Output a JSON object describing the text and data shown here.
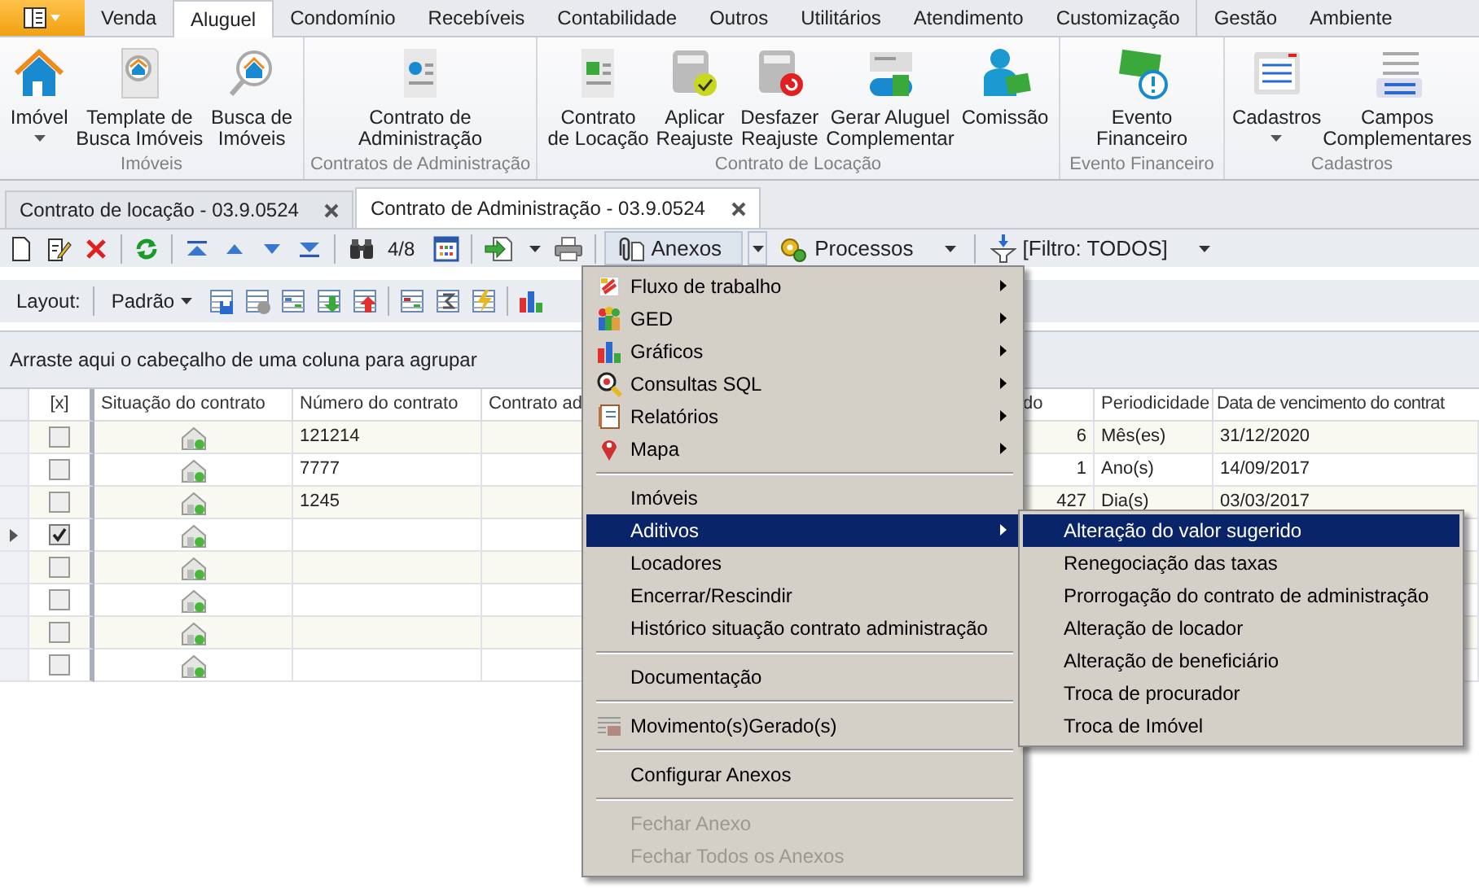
{
  "ribbon": {
    "tabs": [
      {
        "label": "Venda",
        "selected": false
      },
      {
        "label": "Aluguel",
        "selected": true
      },
      {
        "label": "Condomínio",
        "selected": false
      },
      {
        "label": "Recebíveis",
        "selected": false
      },
      {
        "label": "Contabilidade",
        "selected": false
      },
      {
        "label": "Outros",
        "selected": false
      },
      {
        "label": "Utilitários",
        "selected": false
      },
      {
        "label": "Atendimento",
        "selected": false
      },
      {
        "label": "Customização",
        "selected": false
      },
      {
        "label": "Gestão",
        "selected": false
      },
      {
        "label": "Ambiente",
        "selected": false
      }
    ],
    "groups": [
      {
        "title": "Imóveis",
        "buttons": [
          {
            "lines": [
              "Imóvel"
            ],
            "dropdown": true
          },
          {
            "lines": [
              "Template de",
              "Busca Imóveis"
            ],
            "dropdown": false
          },
          {
            "lines": [
              "Busca de",
              "Imóveis"
            ],
            "dropdown": false
          }
        ]
      },
      {
        "title": "Contratos de Administração",
        "buttons": [
          {
            "lines": [
              "Contrato de",
              "Administração"
            ],
            "dropdown": false
          }
        ]
      },
      {
        "title": "Contrato de Locação",
        "buttons": [
          {
            "lines": [
              "Contrato",
              "de Locação"
            ],
            "dropdown": false
          },
          {
            "lines": [
              "Aplicar",
              "Reajuste"
            ],
            "dropdown": false
          },
          {
            "lines": [
              "Desfazer",
              "Reajuste"
            ],
            "dropdown": false
          },
          {
            "lines": [
              "Gerar Aluguel",
              "Complementar"
            ],
            "dropdown": false
          },
          {
            "lines": [
              "Comissão"
            ],
            "dropdown": false
          }
        ]
      },
      {
        "title": "Evento Financeiro",
        "buttons": [
          {
            "lines": [
              "Evento",
              "Financeiro"
            ],
            "dropdown": false
          }
        ]
      },
      {
        "title": "Cadastros",
        "buttons": [
          {
            "lines": [
              "Cadastros"
            ],
            "dropdown": true
          },
          {
            "lines": [
              "Campos",
              "Complementares"
            ],
            "dropdown": false
          }
        ]
      }
    ]
  },
  "document_tabs": [
    {
      "label": "Contrato de locação - 03.9.0524",
      "selected": false
    },
    {
      "label": "Contrato de Administração - 03.9.0524",
      "selected": true
    }
  ],
  "toolbar": {
    "record_counter": "4/8",
    "attachments": "Anexos",
    "processes": "Processos",
    "filter": "[Filtro: TODOS]"
  },
  "layout_bar": {
    "label": "Layout:",
    "value": "Padrão"
  },
  "group_panel": "Arraste aqui o cabeçalho de uma coluna para agrupar",
  "table": {
    "columns": [
      "[x]",
      "Situação do contrato",
      "Número do contrato",
      "Contrato ad",
      "do",
      "Periodicidade",
      "Data de vencimento do contrat"
    ],
    "rows": [
      {
        "checked": false,
        "current": false,
        "number": "121214",
        "column_5": "6",
        "period": "Mês(es)",
        "due_date": "31/12/2020"
      },
      {
        "checked": false,
        "current": false,
        "number": "7777",
        "column_5": "1",
        "period": "Ano(s)",
        "due_date": "14/09/2017"
      },
      {
        "checked": false,
        "current": false,
        "number": "1245",
        "column_5": "427",
        "period": "Dia(s)",
        "due_date": "03/03/2017"
      },
      {
        "checked": true,
        "current": true
      },
      {
        "checked": false,
        "current": false
      },
      {
        "checked": false,
        "current": false
      },
      {
        "checked": false,
        "current": false
      },
      {
        "checked": false,
        "current": false
      }
    ]
  },
  "menu": {
    "items": [
      {
        "kind": "item",
        "label": "Fluxo de trabalho",
        "submenu": true,
        "selected": false,
        "disabled": false
      },
      {
        "kind": "item",
        "label": "GED",
        "submenu": true,
        "selected": false,
        "disabled": false
      },
      {
        "kind": "item",
        "label": "Gráficos",
        "submenu": true,
        "selected": false,
        "disabled": false
      },
      {
        "kind": "item",
        "label": "Consultas SQL",
        "submenu": true,
        "selected": false,
        "disabled": false
      },
      {
        "kind": "item",
        "label": "Relatórios",
        "submenu": true,
        "selected": false,
        "disabled": false
      },
      {
        "kind": "item",
        "label": "Mapa",
        "submenu": true,
        "selected": false,
        "disabled": false
      },
      {
        "kind": "separator"
      },
      {
        "kind": "item",
        "label": "Imóveis",
        "submenu": false,
        "selected": false,
        "disabled": false
      },
      {
        "kind": "item",
        "label": "Aditivos",
        "submenu": true,
        "selected": true,
        "disabled": false
      },
      {
        "kind": "item",
        "label": "Locadores",
        "submenu": false,
        "selected": false,
        "disabled": false
      },
      {
        "kind": "item",
        "label": "Encerrar/Rescindir",
        "submenu": false,
        "selected": false,
        "disabled": false
      },
      {
        "kind": "item",
        "label": "Histórico situação contrato administração",
        "submenu": false,
        "selected": false,
        "disabled": false
      },
      {
        "kind": "separator"
      },
      {
        "kind": "item",
        "label": "Documentação",
        "submenu": false,
        "selected": false,
        "disabled": false
      },
      {
        "kind": "separator"
      },
      {
        "kind": "item",
        "label": "Movimento(s)Gerado(s)",
        "submenu": false,
        "selected": false,
        "disabled": false
      },
      {
        "kind": "separator"
      },
      {
        "kind": "item",
        "label": "Configurar Anexos",
        "submenu": false,
        "selected": false,
        "disabled": false
      },
      {
        "kind": "separator"
      },
      {
        "kind": "item",
        "label": "Fechar Anexo",
        "submenu": false,
        "selected": false,
        "disabled": true
      },
      {
        "kind": "item",
        "label": "Fechar Todos os Anexos",
        "submenu": false,
        "selected": false,
        "disabled": true
      }
    ]
  },
  "submenu": {
    "items": [
      {
        "label": "Alteração do valor sugerido",
        "selected": true
      },
      {
        "label": "Renegociação das taxas",
        "selected": false
      },
      {
        "label": "Prorrogação do contrato de administração",
        "selected": false
      },
      {
        "label": "Alteração de locador",
        "selected": false
      },
      {
        "label": "Alteração de beneficiário",
        "selected": false
      },
      {
        "label": "Troca de procurador",
        "selected": false
      },
      {
        "label": "Troca de Imóvel",
        "selected": false
      }
    ]
  }
}
